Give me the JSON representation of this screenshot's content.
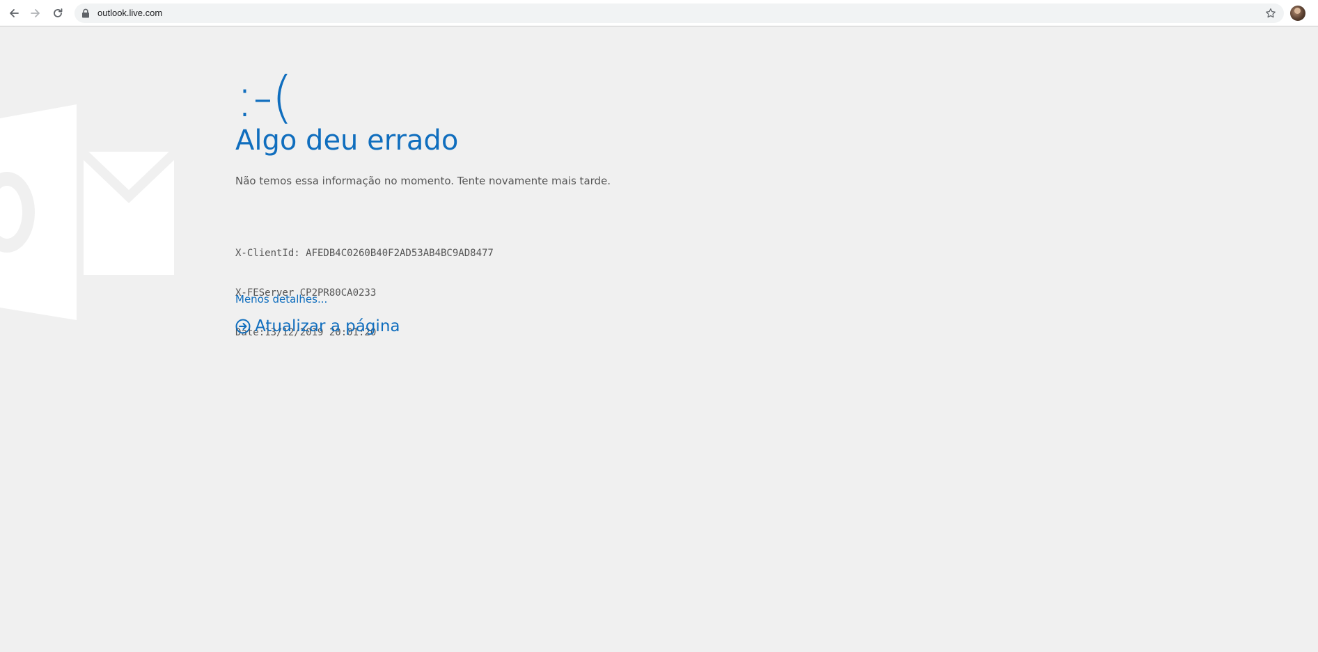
{
  "browser": {
    "url": "outlook.live.com",
    "icons": {
      "back": "back-arrow-icon",
      "forward": "forward-arrow-icon",
      "reload": "reload-icon",
      "lock": "lock-icon",
      "bookmark": "star-icon"
    }
  },
  "error": {
    "face": ":-(",
    "title": "Algo deu errado",
    "message": "Não temos essa informação no momento. Tente novamente mais tarde.",
    "diagnostics": [
      "X-ClientId: AFEDB4C0260B40F2AD53AB4BC9AD8477",
      "X-FEServer CP2PR80CA0233",
      "Date:13/12/2019 20:01:20"
    ],
    "details_link": "Menos detalhes...",
    "refresh_label": "Atualizar a página"
  },
  "colors": {
    "accent": "#106ebe",
    "text_muted": "#555555",
    "background": "#f0f0f0"
  }
}
